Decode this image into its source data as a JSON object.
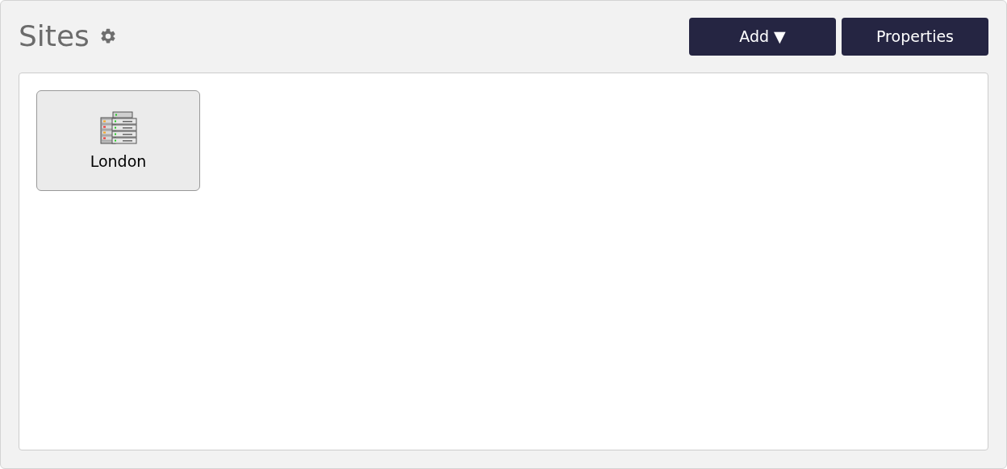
{
  "header": {
    "title": "Sites"
  },
  "buttons": [
    {
      "label": "Add ▼"
    },
    {
      "label": "Properties"
    }
  ],
  "sites": [
    {
      "name": "London"
    }
  ]
}
